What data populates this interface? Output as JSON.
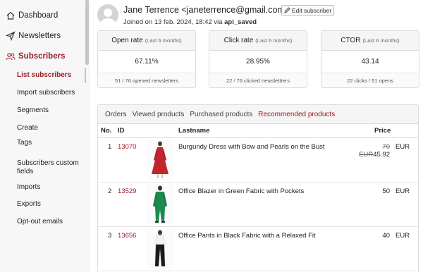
{
  "sidebar": {
    "items": [
      {
        "label": "Dashboard",
        "icon": "home-icon"
      },
      {
        "label": "Newsletters",
        "icon": "send-icon"
      },
      {
        "label": "Subscribers",
        "icon": "users-icon"
      }
    ],
    "subitems": [
      {
        "label": "List subscribers"
      },
      {
        "label": "Import subscribers"
      },
      {
        "label": "Segments"
      },
      {
        "label": "Create"
      },
      {
        "label": "Tags"
      },
      {
        "label": "Subscribers custom fields"
      },
      {
        "label": "Imports"
      },
      {
        "label": "Exports"
      },
      {
        "label": "Opt-out emails"
      }
    ]
  },
  "subscriber": {
    "name": "Jane Terrence <janeterrence@gmail.com>",
    "edit_label": "Edit subscriber",
    "joined_prefix": "Joined on 13 feb. 2024, 18:42 via ",
    "joined_via": "api_saved"
  },
  "stats": [
    {
      "title": "Open rate",
      "period": "(Last 6 months)",
      "value": "67.11%",
      "foot": "51 / 76 opened newsletters"
    },
    {
      "title": "Click rate",
      "period": "(Last 6 months)",
      "value": "28.95%",
      "foot": "22 / 76 clicked newslettters"
    },
    {
      "title": "CTOR",
      "period": "(Last 6 months)",
      "value": "43.14",
      "foot": "22 clicks / 51 opens"
    }
  ],
  "tabs": [
    {
      "label": "Orders"
    },
    {
      "label": "Viewed products"
    },
    {
      "label": "Purchased products"
    },
    {
      "label": "Recommended products"
    }
  ],
  "table": {
    "headers": {
      "no": "No.",
      "id": "ID",
      "lastname": "Lastname",
      "price": "Price"
    },
    "rows": [
      {
        "no": "1",
        "id": "13070",
        "title": "Burgundy Dress with Bow and Pearls on the Bust",
        "old_price": "70 EUR",
        "price": "45.92",
        "currency": "EUR"
      },
      {
        "no": "2",
        "id": "13529",
        "title": "Office Blazer in Green Fabric with Pockets",
        "old_price": "",
        "price": "50",
        "currency": "EUR"
      },
      {
        "no": "3",
        "id": "13656",
        "title": "Office Pants in Black Fabric with a Relaxed Fit",
        "old_price": "",
        "price": "40",
        "currency": "EUR"
      }
    ]
  },
  "colors": {
    "accent": "#9b1c24"
  }
}
